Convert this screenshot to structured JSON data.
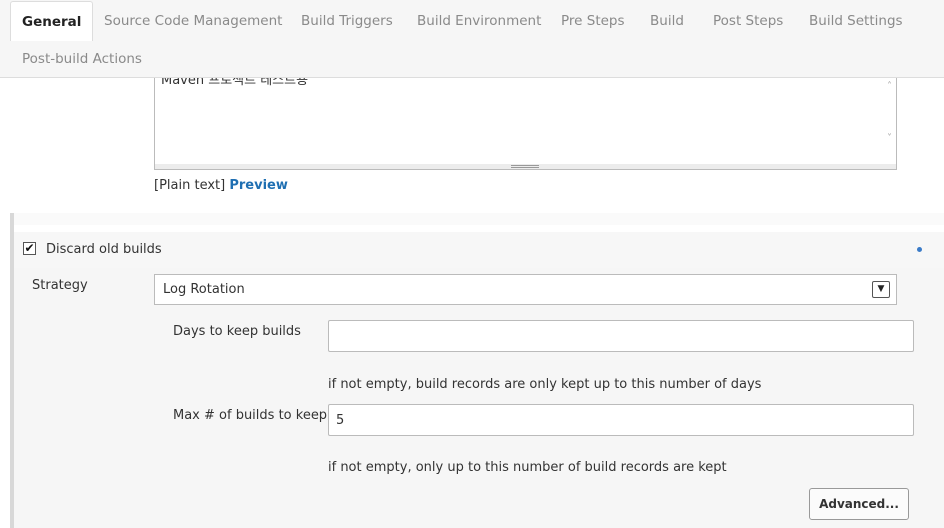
{
  "tabs": [
    {
      "label": "General",
      "active": true
    },
    {
      "label": "Source Code Management"
    },
    {
      "label": "Build Triggers"
    },
    {
      "label": "Build Environment"
    },
    {
      "label": "Pre Steps"
    },
    {
      "label": "Build"
    },
    {
      "label": "Post Steps"
    },
    {
      "label": "Build Settings"
    },
    {
      "label": "Post-build Actions"
    }
  ],
  "description": {
    "text": "Maven 프로젝트 테스트용",
    "format_prefix": "[Plain text]",
    "preview_label": "Preview"
  },
  "discard_old_builds": {
    "label": "Discard old builds",
    "checked": true,
    "check_glyph": "✔",
    "strategy_label": "Strategy",
    "strategy_value": "Log Rotation",
    "days_label": "Days to keep builds",
    "days_value": "",
    "days_hint": "if not empty, build records are only kept up to this number of days",
    "max_label": "Max # of builds to keep",
    "max_value": "5",
    "max_hint": "if not empty, only up to this number of build records are kept",
    "advanced_label": "Advanced..."
  },
  "colors": {
    "link": "#1f6fb2",
    "help_dot": "#3a7bc8"
  }
}
